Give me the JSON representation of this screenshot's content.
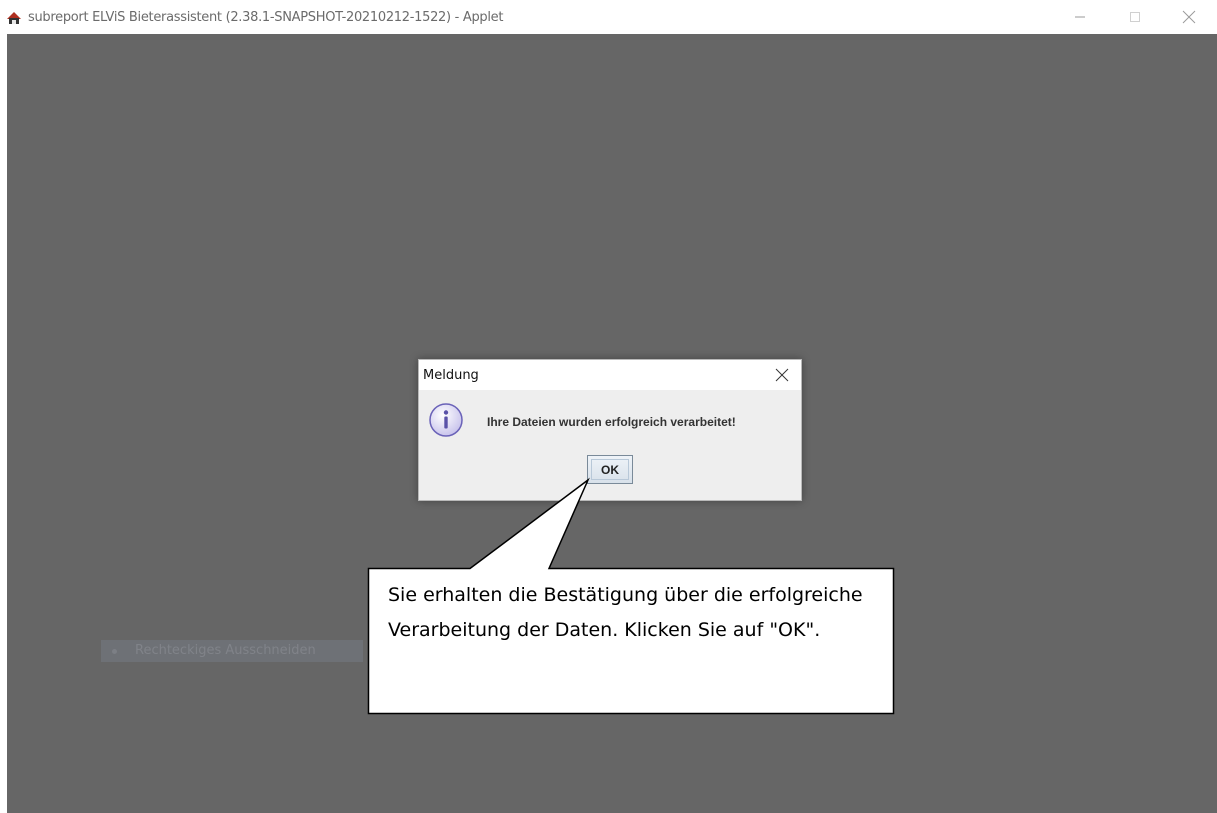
{
  "window": {
    "title": "subreport ELViS Bieterassistent (2.38.1-SNAPSHOT-20210212-1522) - Applet",
    "controls": [
      "minimize-icon",
      "maximize-icon",
      "close-icon"
    ]
  },
  "background": {
    "ghost_item_label": "Rechteckiges Ausschneiden"
  },
  "dialog": {
    "title": "Meldung",
    "icon": "info-icon",
    "message": "Ihre Dateien wurden erfolgreich verarbeitet!",
    "ok_label": "OK"
  },
  "callout": {
    "text": "Sie erhalten die Bestätigung über die erfolgreiche Verarbeitung der Daten. Klicken Sie auf \"OK\"."
  },
  "colors": {
    "applet_background": "#666666",
    "dialog_background": "#eeeeee",
    "callout_fill": "#ffffff",
    "callout_stroke": "#000000"
  }
}
